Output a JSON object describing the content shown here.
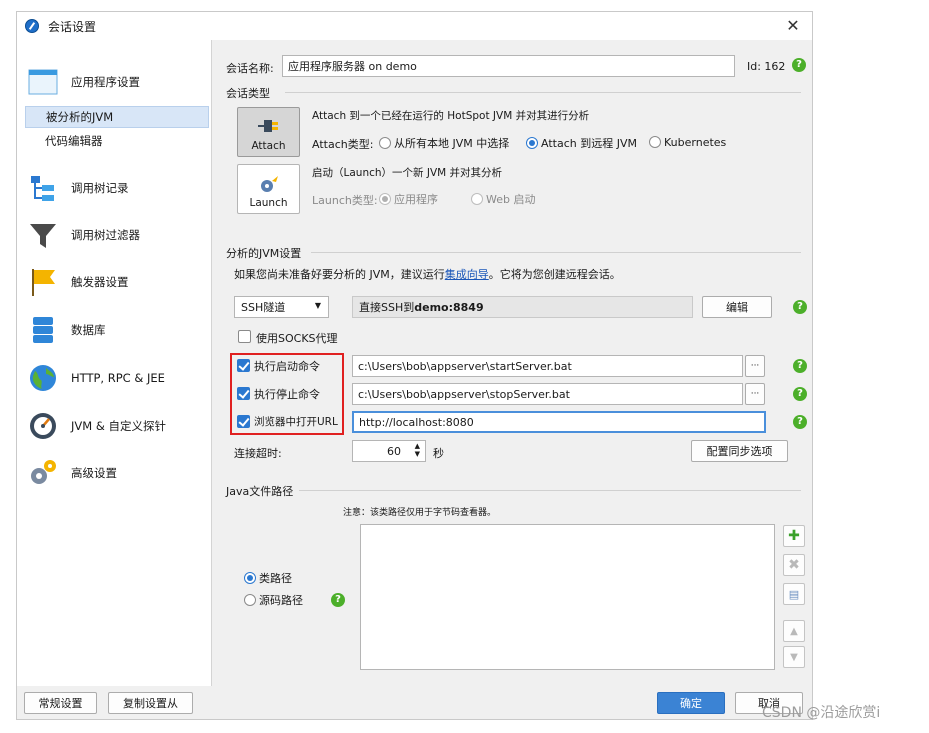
{
  "window": {
    "title": "会话设置",
    "close": "✕"
  },
  "sidebar": {
    "app_settings": "应用程序设置",
    "profiled_jvm": "被分析的JVM",
    "code_editor": "代码编辑器",
    "call_tree_record": "调用树记录",
    "call_tree_filter": "调用树过滤器",
    "trigger_settings": "触发器设置",
    "database": "数据库",
    "http": "HTTP, RPC & JEE",
    "jvm_probes": "JVM & 自定义探针",
    "advanced": "高级设置"
  },
  "session": {
    "name_label": "会话名称:",
    "name_value": "应用程序服务器 on demo",
    "id_label": "Id: 162"
  },
  "session_type": {
    "heading": "会话类型",
    "attach_desc": "Attach 到一个已经在运行的 HotSpot JVM 并对其进行分析",
    "attach_button": "Attach",
    "attach_type_label": "Attach类型:",
    "attach_options": [
      "从所有本地 JVM 中选择",
      "Attach 到远程 JVM",
      "Kubernetes"
    ],
    "attach_selected": 1,
    "launch_desc": "启动（Launch）一个新 JVM 并对其分析",
    "launch_button": "Launch",
    "launch_type_label": "Launch类型:",
    "launch_options": [
      "应用程序",
      "Web 启动"
    ]
  },
  "jvm_settings": {
    "heading": "分析的JVM设置",
    "hint_prefix": "如果您尚未准备好要分析的 JVM，建议运行",
    "hint_link": "集成向导",
    "hint_suffix": "。它将为您创建远程会话。",
    "tunnel_select": "SSH隧道",
    "tunnel_value_prefix": "直接SSH到 ",
    "tunnel_value_host": "demo:8849",
    "edit_button": "编辑",
    "socks_label": "使用SOCKS代理",
    "socks_checked": false,
    "start_cmd_label": "执行启动命令",
    "start_cmd_value": "c:\\Users\\bob\\appserver\\startServer.bat",
    "stop_cmd_label": "执行停止命令",
    "stop_cmd_value": "c:\\Users\\bob\\appserver\\stopServer.bat",
    "browser_label": "浏览器中打开URL",
    "browser_value": "http://localhost:8080",
    "browse_button": "···",
    "timeout_label": "连接超时:",
    "timeout_value": "60",
    "timeout_unit": "秒",
    "sync_button": "配置同步选项"
  },
  "java_path": {
    "heading": "Java文件路径",
    "note": "注意：该类路径仅用于字节码查看器。",
    "classpath_label": "类路径",
    "sourcepath_label": "源码路径",
    "selected": 0
  },
  "footer": {
    "general_button": "常规设置",
    "copy_button": "复制设置从",
    "ok_button": "确定",
    "cancel_button": "取消"
  },
  "help_glyph": "?",
  "watermark": "CSDN @沿途欣赏i",
  "colors": {
    "accent": "#2b78d0",
    "highlight_box": "#e02020",
    "help_green": "#4caf2a",
    "link": "#1a56b8"
  }
}
